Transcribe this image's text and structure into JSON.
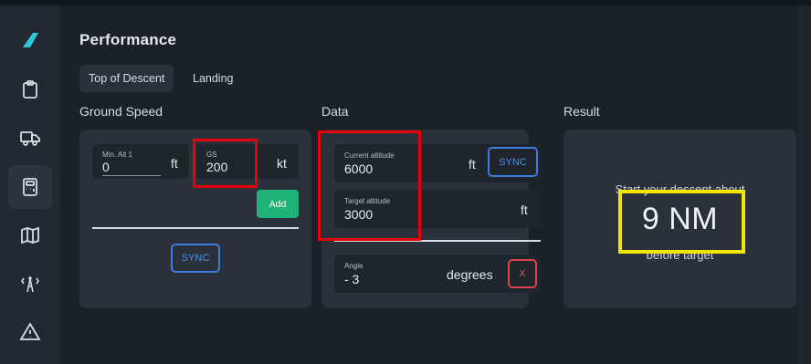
{
  "sidebar": {
    "icons": [
      "logo-icon",
      "clipboard-icon",
      "truck-icon",
      "calculator-icon",
      "map-icon",
      "tower-icon",
      "warning-icon"
    ],
    "active": "calculator-icon"
  },
  "page": {
    "title": "Performance"
  },
  "tabs": [
    {
      "label": "Top of Descent",
      "active": true
    },
    {
      "label": "Landing",
      "active": false
    }
  ],
  "ground_speed": {
    "title": "Ground Speed",
    "min_alt": {
      "label": "Min. Alt 1",
      "value": "0",
      "unit": "ft"
    },
    "gs": {
      "label": "GS",
      "value": "200",
      "unit": "kt"
    },
    "add_label": "Add",
    "sync_label": "SYNC"
  },
  "data": {
    "title": "Data",
    "current_altitude": {
      "label": "Current altitude",
      "value": "6000",
      "unit": "ft"
    },
    "sync_label": "SYNC",
    "target_altitude": {
      "label": "Target altitude",
      "value": "3000",
      "unit": "ft"
    },
    "angle": {
      "label": "Angle",
      "value": "- 3",
      "unit": "degrees"
    },
    "clear_label": "X"
  },
  "result": {
    "title": "Result",
    "prefix": "Start your descent about",
    "value": "9 NM",
    "suffix": "before target"
  },
  "colors": {
    "accent_blue": "#3b7ddd",
    "add_green": "#1fb37a",
    "clear_red": "#d9454a",
    "highlight_red": "#e8000b",
    "highlight_yellow": "#f2e600",
    "logo_cyan": "#2fc7d8"
  }
}
